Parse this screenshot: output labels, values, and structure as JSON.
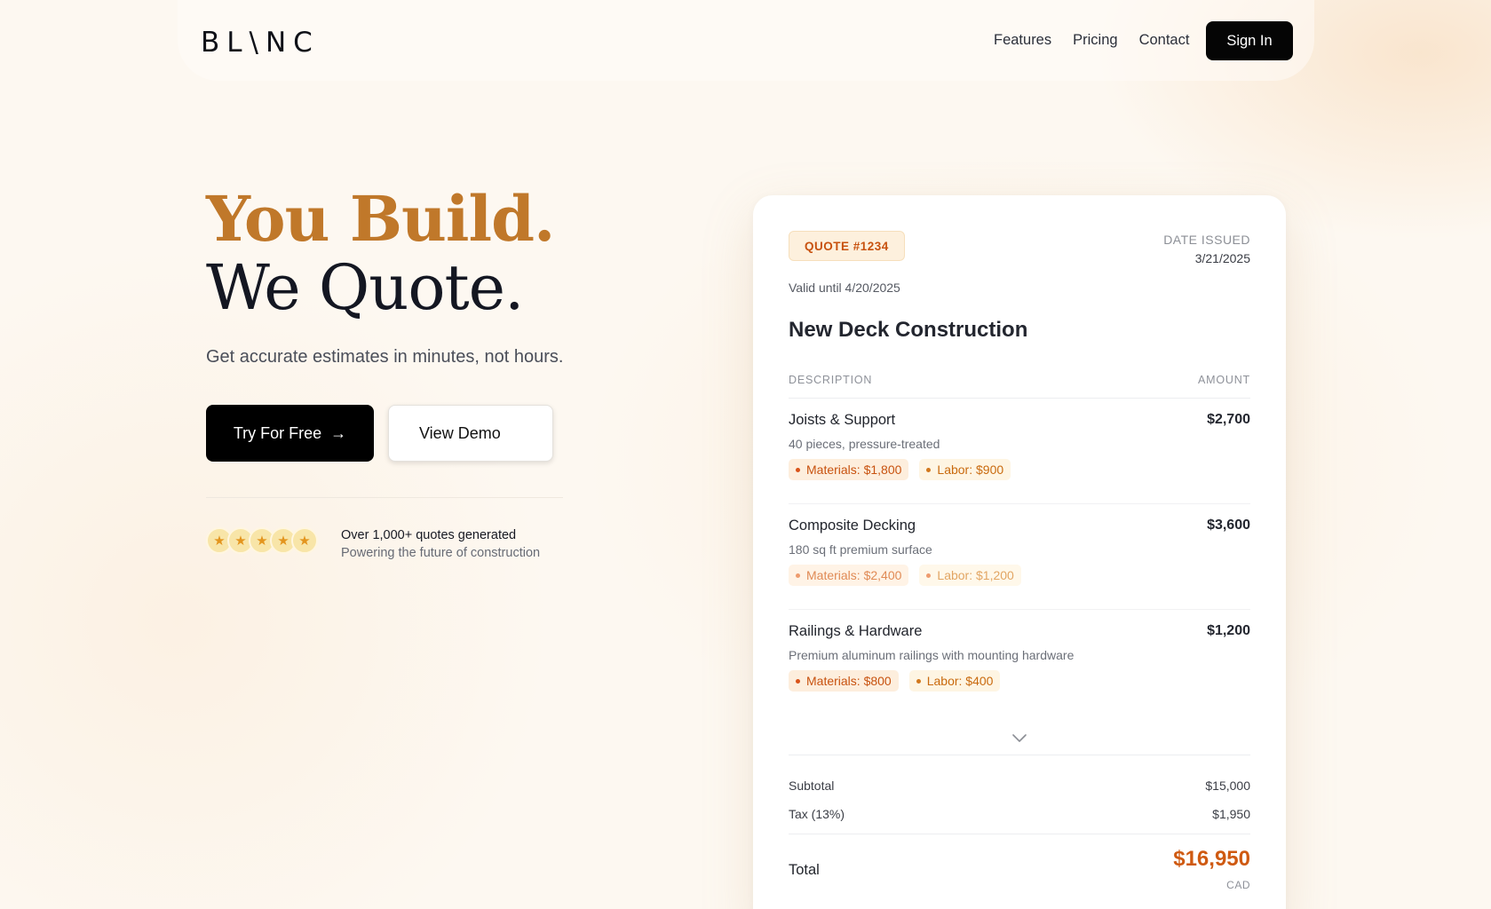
{
  "brand": {
    "logo": "BL\\NC"
  },
  "nav": {
    "links": [
      "Features",
      "Pricing",
      "Contact"
    ],
    "sign_in": "Sign In"
  },
  "hero": {
    "headline_1": "You Build.",
    "headline_2": "We Quote.",
    "subtitle": "Get accurate estimates in minutes, not hours.",
    "primary_cta": "Try For Free",
    "primary_cta_arrow": "→",
    "secondary_cta": "View Demo",
    "rating_stars": 5,
    "social_title": "Over 1,000+ quotes generated",
    "social_sub": "Powering the future of construction"
  },
  "quote": {
    "badge": "QUOTE #1234",
    "date_label": "DATE ISSUED",
    "date_value": "3/21/2025",
    "valid_until": "Valid until 4/20/2025",
    "title": "New Deck Construction",
    "col_description": "DESCRIPTION",
    "col_amount": "AMOUNT",
    "items": [
      {
        "name": "Joists & Support",
        "amount": "$2,700",
        "detail": "40 pieces, pressure-treated",
        "materials": "Materials: $1,800",
        "labor": "Labor: $900"
      },
      {
        "name": "Composite Decking",
        "amount": "$3,600",
        "detail": "180 sq ft premium surface",
        "materials": "Materials: $2,400",
        "labor": "Labor: $1,200"
      },
      {
        "name": "Railings & Hardware",
        "amount": "$1,200",
        "detail": "Premium aluminum railings with mounting hardware",
        "materials": "Materials: $800",
        "labor": "Labor: $400"
      }
    ],
    "subtotal_label": "Subtotal",
    "subtotal_value": "$15,000",
    "tax_label": "Tax (13%)",
    "tax_value": "$1,950",
    "total_label": "Total",
    "total_value": "$16,950",
    "currency": "CAD"
  },
  "colors": {
    "accent_gold": "#c0782a",
    "accent_orange": "#cf5a12",
    "ink": "#141722"
  }
}
